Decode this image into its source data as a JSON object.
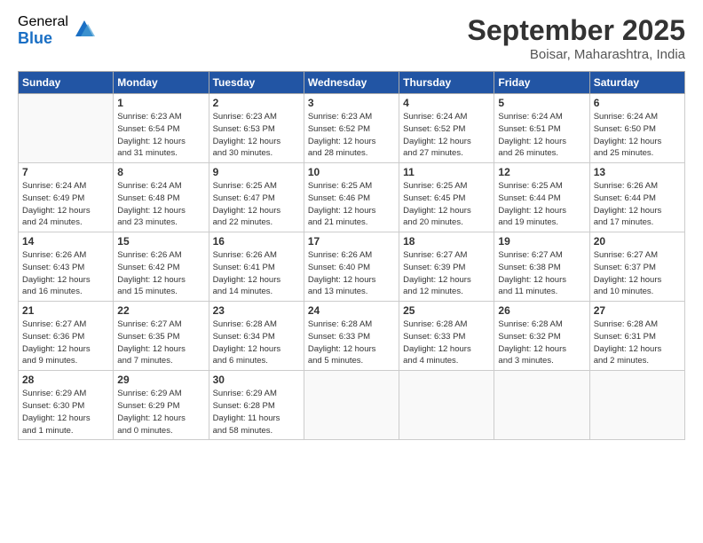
{
  "logo": {
    "general": "General",
    "blue": "Blue"
  },
  "header": {
    "month": "September 2025",
    "location": "Boisar, Maharashtra, India"
  },
  "weekdays": [
    "Sunday",
    "Monday",
    "Tuesday",
    "Wednesday",
    "Thursday",
    "Friday",
    "Saturday"
  ],
  "weeks": [
    [
      {
        "day": "",
        "info": ""
      },
      {
        "day": "1",
        "info": "Sunrise: 6:23 AM\nSunset: 6:54 PM\nDaylight: 12 hours\nand 31 minutes."
      },
      {
        "day": "2",
        "info": "Sunrise: 6:23 AM\nSunset: 6:53 PM\nDaylight: 12 hours\nand 30 minutes."
      },
      {
        "day": "3",
        "info": "Sunrise: 6:23 AM\nSunset: 6:52 PM\nDaylight: 12 hours\nand 28 minutes."
      },
      {
        "day": "4",
        "info": "Sunrise: 6:24 AM\nSunset: 6:52 PM\nDaylight: 12 hours\nand 27 minutes."
      },
      {
        "day": "5",
        "info": "Sunrise: 6:24 AM\nSunset: 6:51 PM\nDaylight: 12 hours\nand 26 minutes."
      },
      {
        "day": "6",
        "info": "Sunrise: 6:24 AM\nSunset: 6:50 PM\nDaylight: 12 hours\nand 25 minutes."
      }
    ],
    [
      {
        "day": "7",
        "info": "Sunrise: 6:24 AM\nSunset: 6:49 PM\nDaylight: 12 hours\nand 24 minutes."
      },
      {
        "day": "8",
        "info": "Sunrise: 6:24 AM\nSunset: 6:48 PM\nDaylight: 12 hours\nand 23 minutes."
      },
      {
        "day": "9",
        "info": "Sunrise: 6:25 AM\nSunset: 6:47 PM\nDaylight: 12 hours\nand 22 minutes."
      },
      {
        "day": "10",
        "info": "Sunrise: 6:25 AM\nSunset: 6:46 PM\nDaylight: 12 hours\nand 21 minutes."
      },
      {
        "day": "11",
        "info": "Sunrise: 6:25 AM\nSunset: 6:45 PM\nDaylight: 12 hours\nand 20 minutes."
      },
      {
        "day": "12",
        "info": "Sunrise: 6:25 AM\nSunset: 6:44 PM\nDaylight: 12 hours\nand 19 minutes."
      },
      {
        "day": "13",
        "info": "Sunrise: 6:26 AM\nSunset: 6:44 PM\nDaylight: 12 hours\nand 17 minutes."
      }
    ],
    [
      {
        "day": "14",
        "info": "Sunrise: 6:26 AM\nSunset: 6:43 PM\nDaylight: 12 hours\nand 16 minutes."
      },
      {
        "day": "15",
        "info": "Sunrise: 6:26 AM\nSunset: 6:42 PM\nDaylight: 12 hours\nand 15 minutes."
      },
      {
        "day": "16",
        "info": "Sunrise: 6:26 AM\nSunset: 6:41 PM\nDaylight: 12 hours\nand 14 minutes."
      },
      {
        "day": "17",
        "info": "Sunrise: 6:26 AM\nSunset: 6:40 PM\nDaylight: 12 hours\nand 13 minutes."
      },
      {
        "day": "18",
        "info": "Sunrise: 6:27 AM\nSunset: 6:39 PM\nDaylight: 12 hours\nand 12 minutes."
      },
      {
        "day": "19",
        "info": "Sunrise: 6:27 AM\nSunset: 6:38 PM\nDaylight: 12 hours\nand 11 minutes."
      },
      {
        "day": "20",
        "info": "Sunrise: 6:27 AM\nSunset: 6:37 PM\nDaylight: 12 hours\nand 10 minutes."
      }
    ],
    [
      {
        "day": "21",
        "info": "Sunrise: 6:27 AM\nSunset: 6:36 PM\nDaylight: 12 hours\nand 9 minutes."
      },
      {
        "day": "22",
        "info": "Sunrise: 6:27 AM\nSunset: 6:35 PM\nDaylight: 12 hours\nand 7 minutes."
      },
      {
        "day": "23",
        "info": "Sunrise: 6:28 AM\nSunset: 6:34 PM\nDaylight: 12 hours\nand 6 minutes."
      },
      {
        "day": "24",
        "info": "Sunrise: 6:28 AM\nSunset: 6:33 PM\nDaylight: 12 hours\nand 5 minutes."
      },
      {
        "day": "25",
        "info": "Sunrise: 6:28 AM\nSunset: 6:33 PM\nDaylight: 12 hours\nand 4 minutes."
      },
      {
        "day": "26",
        "info": "Sunrise: 6:28 AM\nSunset: 6:32 PM\nDaylight: 12 hours\nand 3 minutes."
      },
      {
        "day": "27",
        "info": "Sunrise: 6:28 AM\nSunset: 6:31 PM\nDaylight: 12 hours\nand 2 minutes."
      }
    ],
    [
      {
        "day": "28",
        "info": "Sunrise: 6:29 AM\nSunset: 6:30 PM\nDaylight: 12 hours\nand 1 minute."
      },
      {
        "day": "29",
        "info": "Sunrise: 6:29 AM\nSunset: 6:29 PM\nDaylight: 12 hours\nand 0 minutes."
      },
      {
        "day": "30",
        "info": "Sunrise: 6:29 AM\nSunset: 6:28 PM\nDaylight: 11 hours\nand 58 minutes."
      },
      {
        "day": "",
        "info": ""
      },
      {
        "day": "",
        "info": ""
      },
      {
        "day": "",
        "info": ""
      },
      {
        "day": "",
        "info": ""
      }
    ]
  ]
}
